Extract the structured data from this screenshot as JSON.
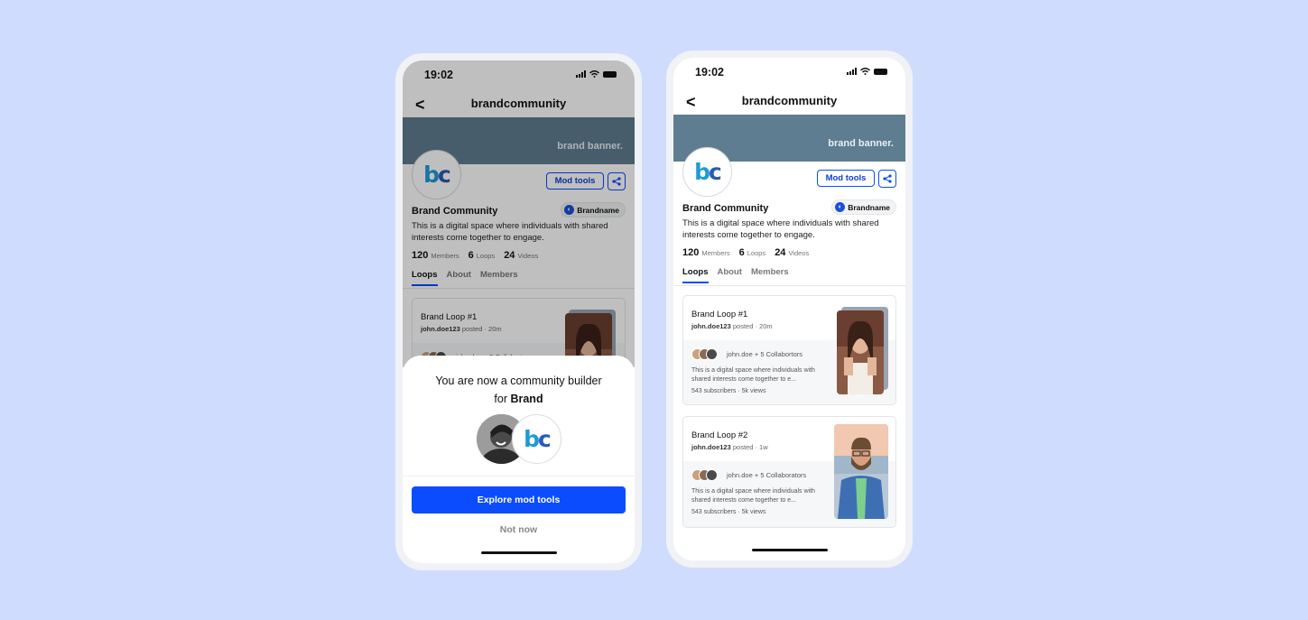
{
  "status": {
    "time": "19:02"
  },
  "nav": {
    "back": "<",
    "title": "brandcommunity"
  },
  "banner": {
    "text": "brand banner."
  },
  "logo": {
    "part1": "b",
    "part2": "c"
  },
  "actions": {
    "mod_tools": "Mod tools"
  },
  "community": {
    "name": "Brand Community",
    "brand_chip": "Brandname",
    "description": "This is a digital space where individuals with shared interests come together to engage."
  },
  "stats": [
    {
      "value": "120",
      "label": "Members"
    },
    {
      "value": "6",
      "label": "Loops"
    },
    {
      "value": "24",
      "label": "Videos"
    }
  ],
  "tabs": [
    "Loops",
    "About",
    "Members"
  ],
  "loops": [
    {
      "title": "Brand Loop #1",
      "author": "john.doe123",
      "posted": "posted · 20m",
      "collab_phone1": "john.doe + 5 Collabortors",
      "collab_phone2": "john.doe + 5 Collabortors",
      "desc": "This is a digital space where individuals with shared interests come together to e...",
      "subs": "543 subscribers · 5k views"
    },
    {
      "title": "Brand Loop #2",
      "author": "john.doe123",
      "posted": "posted · 1w",
      "collab": "john.doe + 5 Collaborators",
      "desc": "This is a digital space where individuals with shared interests come together to e...",
      "subs": "543 subscribers · 5k views"
    }
  ],
  "sheet": {
    "title_line1": "You are now a community builder",
    "title_for": "for",
    "title_brand": "Brand",
    "cta": "Explore mod tools",
    "dismiss": "Not now"
  },
  "colors": {
    "accent": "#0b4cff",
    "banner": "#5f7d91",
    "background": "#cfdcfd"
  }
}
